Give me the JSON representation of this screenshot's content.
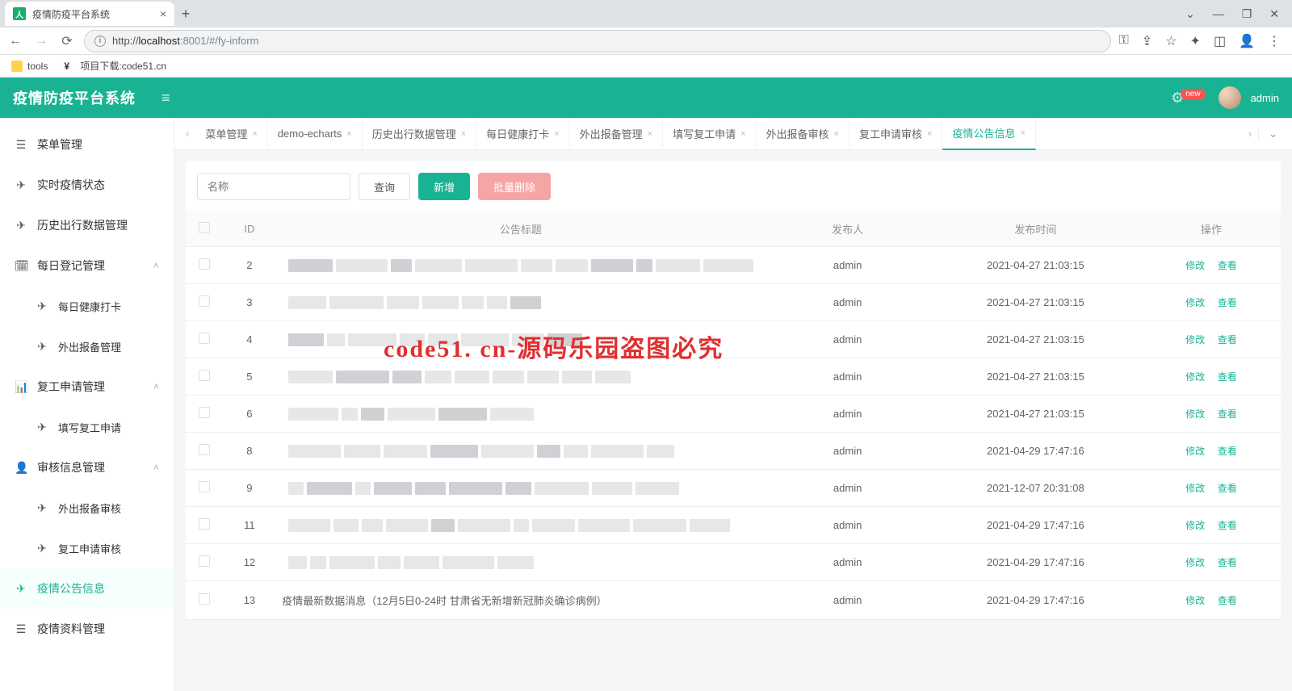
{
  "browser": {
    "tab_title": "疫情防疫平台系统",
    "url_host": "localhost",
    "url_port": ":8001",
    "url_path": "/#/fy-inform",
    "url_prefix": "http://",
    "bookmarks": [
      {
        "label": "tools"
      },
      {
        "label": "项目下载:code51.cn"
      }
    ]
  },
  "header": {
    "brand": "疫情防疫平台系统",
    "badge": "new",
    "user": "admin"
  },
  "sidebar": [
    {
      "icon": "☰",
      "label": "菜单管理",
      "sub": false
    },
    {
      "icon": "✈",
      "label": "实时疫情状态",
      "sub": false
    },
    {
      "icon": "✈",
      "label": "历史出行数据管理",
      "sub": false
    },
    {
      "icon": "🗓",
      "label": "每日登记管理",
      "sub": false,
      "expand": true
    },
    {
      "icon": "✈",
      "label": "每日健康打卡",
      "sub": true
    },
    {
      "icon": "✈",
      "label": "外出报备管理",
      "sub": true
    },
    {
      "icon": "📊",
      "label": "复工申请管理",
      "sub": false,
      "expand": true
    },
    {
      "icon": "✈",
      "label": "填写复工申请",
      "sub": true
    },
    {
      "icon": "👤",
      "label": "审核信息管理",
      "sub": false,
      "expand": true
    },
    {
      "icon": "✈",
      "label": "外出报备审核",
      "sub": true
    },
    {
      "icon": "✈",
      "label": "复工申请审核",
      "sub": true
    },
    {
      "icon": "✈",
      "label": "疫情公告信息",
      "sub": false,
      "active": true
    },
    {
      "icon": "☰",
      "label": "疫情资料管理",
      "sub": false
    }
  ],
  "tabs": [
    {
      "label": "菜单管理"
    },
    {
      "label": "demo-echarts"
    },
    {
      "label": "历史出行数据管理"
    },
    {
      "label": "每日健康打卡"
    },
    {
      "label": "外出报备管理"
    },
    {
      "label": "填写复工申请"
    },
    {
      "label": "外出报备审核"
    },
    {
      "label": "复工申请审核"
    },
    {
      "label": "疫情公告信息",
      "active": true
    }
  ],
  "toolbar": {
    "search_placeholder": "名称",
    "btn_query": "查询",
    "btn_add": "新增",
    "btn_batch_delete": "批量删除"
  },
  "table": {
    "headers": {
      "id": "ID",
      "title": "公告标题",
      "publisher": "发布人",
      "time": "发布时间",
      "op": "操作"
    },
    "op_edit": "修改",
    "op_view": "查看",
    "rows": [
      {
        "id": "2",
        "title": "",
        "publisher": "admin",
        "time": "2021-04-27 21:03:15"
      },
      {
        "id": "3",
        "title": "",
        "publisher": "admin",
        "time": "2021-04-27 21:03:15"
      },
      {
        "id": "4",
        "title": "",
        "publisher": "admin",
        "time": "2021-04-27 21:03:15"
      },
      {
        "id": "5",
        "title": "",
        "publisher": "admin",
        "time": "2021-04-27 21:03:15"
      },
      {
        "id": "6",
        "title": "",
        "publisher": "admin",
        "time": "2021-04-27 21:03:15"
      },
      {
        "id": "8",
        "title": "",
        "publisher": "admin",
        "time": "2021-04-29 17:47:16"
      },
      {
        "id": "9",
        "title": "",
        "publisher": "admin",
        "time": "2021-12-07 20:31:08"
      },
      {
        "id": "11",
        "title": "",
        "publisher": "admin",
        "time": "2021-04-29 17:47:16"
      },
      {
        "id": "12",
        "title": "",
        "publisher": "admin",
        "time": "2021-04-29 17:47:16"
      },
      {
        "id": "13",
        "title": "疫情最新数据消息（12月5日0-24时 甘肃省无新增新冠肺炎确诊病例）",
        "publisher": "admin",
        "time": "2021-04-29 17:47:16"
      }
    ]
  },
  "watermark": "code51. cn-源码乐园盗图必究"
}
